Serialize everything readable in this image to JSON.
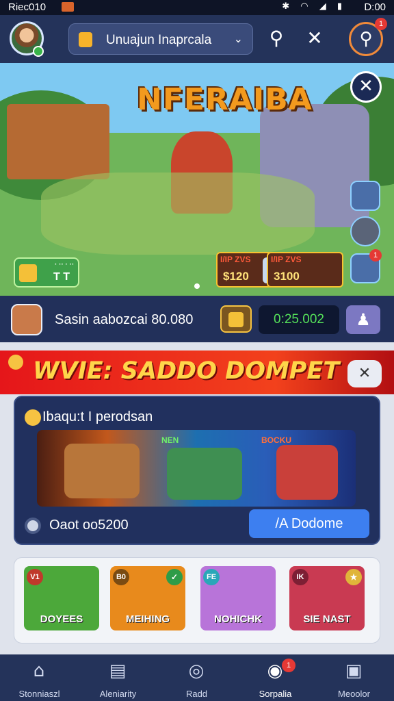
{
  "status": {
    "left_text": "Riec010",
    "right_time": "D:00",
    "icons": "✱ ◠ ◢ ▮"
  },
  "header": {
    "server_label": "Unuajun Inaprcala",
    "chevron": "⌄",
    "search_glyph": "⚲",
    "tools_glyph": "✕",
    "notification_count": "1"
  },
  "hero": {
    "title": "NFERAIBA",
    "close_glyph": "✕",
    "coin_badge": {
      "line1": "· ·· · ··",
      "line2": "T T"
    },
    "offers": [
      {
        "tag": "I/IP ZVS",
        "price": "$120"
      },
      {
        "tag": "I/IP ZVS",
        "price": "3100"
      }
    ],
    "offer_badge_count": "1"
  },
  "account": {
    "text": "Sasin aabozcai 80.080",
    "balance": "0:25.002",
    "user_glyph": "♟"
  },
  "banner": {
    "text": "WVIE: SADDO DOMPET",
    "close_glyph": "✕"
  },
  "promo": {
    "header": "Ibaqu:t I perodsan",
    "tag1": "NEN",
    "tag2": "BOCKU",
    "timer": "Oaot oo5200",
    "button": "/A Dodome"
  },
  "games": [
    {
      "name": "DOYEES",
      "badge": "V1",
      "color": "#4ca83a"
    },
    {
      "name": "MEIHING",
      "badge": "B0",
      "color": "#e88a1c"
    },
    {
      "name": "NOHICHK",
      "badge": "FE",
      "color": "#b874d9"
    },
    {
      "name": "SIE NAST",
      "badge": "IK",
      "color": "#c93a52"
    }
  ],
  "nav": [
    {
      "label": "Stonniaszl",
      "icon": "⌂"
    },
    {
      "label": "Aleniarity",
      "icon": "▤"
    },
    {
      "label": "Radd",
      "icon": "◎"
    },
    {
      "label": "Sorpalia",
      "icon": "◉",
      "badge": "1"
    },
    {
      "label": "Meoolor",
      "icon": "▣"
    }
  ]
}
